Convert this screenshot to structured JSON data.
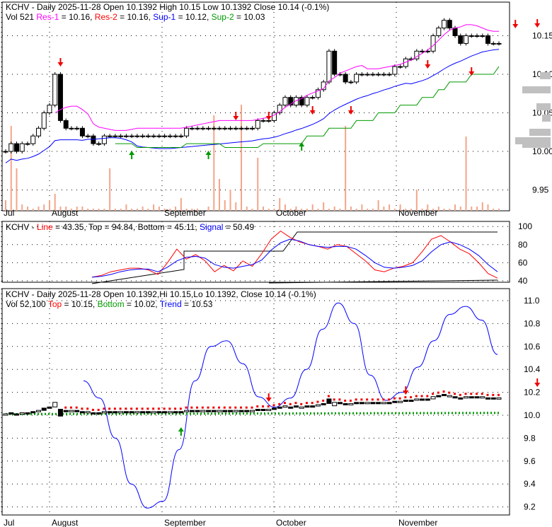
{
  "header1": {
    "line1": "KCHV - Daily 2025-11-28 Open 10.1392  High 10.15  Low 10.1392  Close 10.14 (-0.1%)",
    "vol": "Vol 521",
    "res1": "Res-1",
    "res1_val": " = 10.16,",
    "res2": "Res-2",
    "res2_val": " = 10.16,",
    "sup1": "Sup-1",
    "sup1_val": " = 10.12,",
    "sup2": "Sup-2",
    "sup2_val": " = 10.03"
  },
  "header2": {
    "prefix": "KCHV - ",
    "line": "Line",
    "line_val": " = 43.35, Top = 94.84, Bottom = 45.11, ",
    "signal": "Signal",
    "signal_val": " = 50.49"
  },
  "header3": {
    "line1": "KCHV - Daily 2025-11-28 Open 10.1392,Hi 10.15,Lo 10.1392, Close 10.14 (-0.1%)",
    "vol": "Vol 52,100 ",
    "top": "Top",
    "top_val": " = 10.15, ",
    "bottom": "Bottom",
    "bottom_val": " = 10.02, ",
    "trend": "Trend",
    "trend_val": " = 10.53"
  },
  "colors": {
    "res1": "#ff00ff",
    "res2": "#ff0000",
    "sup1": "#0000ff",
    "sup2": "#009900",
    "volume": "#f4a58a"
  },
  "chart_data": [
    {
      "type": "candlestick",
      "title": "KCHV Daily price",
      "x_labels": [
        "Jul",
        "August",
        "September",
        "October",
        "November"
      ],
      "y_ticks": [
        "10.15",
        "10.10",
        "10.05",
        "10.00",
        "9.95"
      ],
      "ylim": [
        9.92,
        10.19
      ],
      "close": [
        10.0,
        10.01,
        10.0,
        10.01,
        10.01,
        10.02,
        10.03,
        10.05,
        10.06,
        10.1,
        10.04,
        10.03,
        10.03,
        10.03,
        10.02,
        10.02,
        10.01,
        10.01,
        10.02,
        10.02,
        10.02,
        10.02,
        10.02,
        10.02,
        10.02,
        10.02,
        10.02,
        10.02,
        10.02,
        10.02,
        10.02,
        10.02,
        10.02,
        10.03,
        10.03,
        10.03,
        10.03,
        10.03,
        10.03,
        10.03,
        10.03,
        10.03,
        10.03,
        10.03,
        10.03,
        10.03,
        10.04,
        10.04,
        10.04,
        10.05,
        10.06,
        10.07,
        10.06,
        10.07,
        10.06,
        10.07,
        10.07,
        10.08,
        10.09,
        10.13,
        10.1,
        10.1,
        10.09,
        10.09,
        10.1,
        10.1,
        10.1,
        10.1,
        10.1,
        10.1,
        10.1,
        10.11,
        10.11,
        10.12,
        10.12,
        10.13,
        10.13,
        10.13,
        10.15,
        10.16,
        10.17,
        10.16,
        10.15,
        10.14,
        10.15,
        10.15,
        10.15,
        10.15,
        10.14,
        10.14,
        10.14
      ],
      "volume": [
        5,
        40,
        20,
        3,
        2,
        1,
        2,
        3,
        5,
        8,
        2,
        2,
        1,
        2,
        2,
        1,
        1,
        1,
        1,
        20,
        1,
        1,
        3,
        1,
        1,
        2,
        1,
        3,
        2,
        1,
        1,
        2,
        6,
        1,
        1,
        1,
        0,
        2,
        45,
        15,
        5,
        10,
        4,
        50,
        2,
        1,
        25,
        2,
        1,
        1,
        6,
        3,
        1,
        2,
        1,
        1,
        3,
        1,
        4,
        1,
        2,
        1,
        40,
        2,
        1,
        3,
        1,
        1,
        5,
        2,
        3,
        1,
        3,
        1,
        1,
        10,
        1,
        3,
        1,
        2,
        1,
        1,
        3,
        2,
        35,
        2,
        2,
        4,
        3,
        1,
        1
      ]
    },
    {
      "type": "line",
      "title": "Stochastic",
      "y_ticks": [
        "100",
        "80",
        "60",
        "40"
      ],
      "ylim": [
        35,
        100
      ],
      "series": [
        {
          "name": "Line",
          "values": [
            44,
            46,
            50,
            52,
            54,
            54,
            52,
            47,
            60,
            75,
            64,
            69,
            62,
            50,
            57,
            51,
            62,
            56,
            70,
            86,
            95,
            88,
            83,
            80,
            78,
            75,
            80,
            78,
            70,
            62,
            52,
            50,
            54,
            56,
            60,
            72,
            86,
            90,
            83,
            75,
            70,
            60,
            48,
            43
          ]
        },
        {
          "name": "Signal",
          "values": [
            44,
            45,
            47,
            50,
            52,
            53,
            53,
            50,
            55,
            62,
            66,
            67,
            65,
            58,
            55,
            54,
            56,
            58,
            63,
            74,
            82,
            86,
            84,
            80,
            78,
            77,
            78,
            78,
            75,
            68,
            60,
            55,
            54,
            55,
            57,
            62,
            72,
            80,
            83,
            80,
            75,
            68,
            58,
            50
          ]
        }
      ]
    },
    {
      "type": "line",
      "title": "Trend",
      "x_labels": [
        "Jul",
        "August",
        "September",
        "October",
        "November"
      ],
      "y_ticks": [
        "11.0",
        "10.8",
        "10.6",
        "10.4",
        "10.2",
        "10.0",
        "9.8",
        "9.6",
        "9.4",
        "9.2"
      ],
      "ylim": [
        9.14,
        11.1
      ],
      "series": [
        {
          "name": "Trend",
          "values": [
            10.3,
            10.15,
            9.8,
            9.4,
            9.19,
            9.25,
            9.7,
            10.3,
            10.6,
            10.65,
            10.45,
            10.16,
            10.07,
            10.15,
            10.4,
            10.75,
            10.98,
            10.8,
            10.35,
            10.13,
            10.2,
            10.42,
            10.65,
            10.88,
            10.95,
            10.83,
            10.53
          ]
        }
      ]
    }
  ]
}
